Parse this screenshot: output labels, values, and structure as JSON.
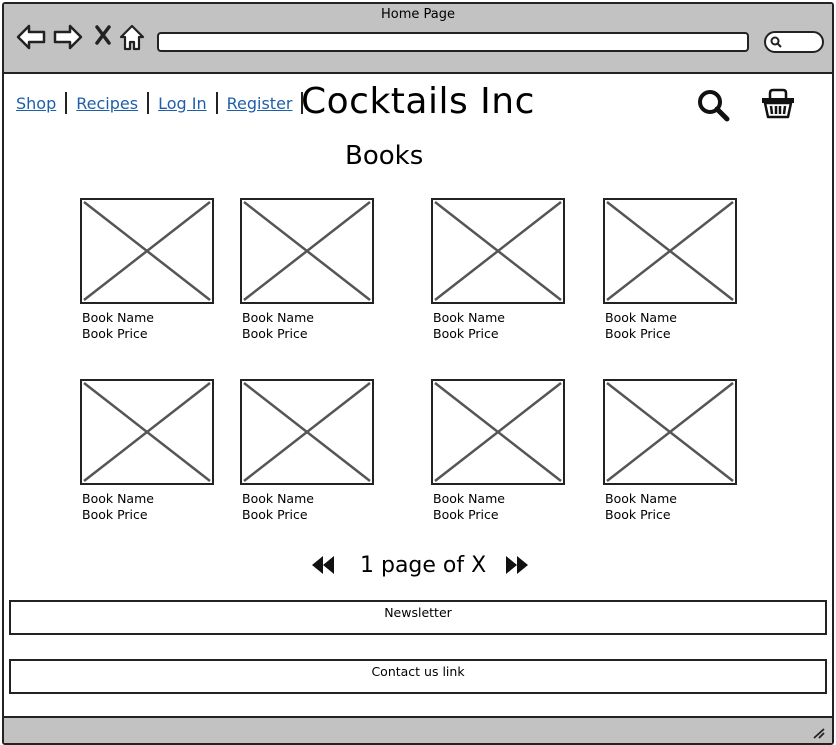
{
  "window": {
    "title": "Home Page"
  },
  "nav": {
    "links": [
      "Shop",
      "Recipes",
      "Log In",
      "Register"
    ]
  },
  "brand": {
    "name": "Cocktails Inc"
  },
  "section": {
    "heading": "Books"
  },
  "books": [
    {
      "name": "Book Name",
      "price": "Book Price"
    },
    {
      "name": "Book Name",
      "price": "Book Price"
    },
    {
      "name": "Book Name",
      "price": "Book Price"
    },
    {
      "name": "Book Name",
      "price": "Book Price"
    },
    {
      "name": "Book Name",
      "price": "Book Price"
    },
    {
      "name": "Book Name",
      "price": "Book Price"
    },
    {
      "name": "Book Name",
      "price": "Book Price"
    },
    {
      "name": "Book Name",
      "price": "Book Price"
    }
  ],
  "pagination": {
    "label": "1 page of X"
  },
  "footer": {
    "newsletter": "Newsletter",
    "contact": "Contact us link"
  },
  "icons": {
    "back": "back-arrow-icon",
    "forward": "forward-arrow-icon",
    "stop": "close-icon",
    "home": "home-icon",
    "search": "search-icon",
    "basket": "basket-icon",
    "prev": "rewind-icon",
    "next": "fast-forward-icon"
  },
  "colors": {
    "chrome": "#c2c2c2",
    "link": "#1f5fa8",
    "stroke": "#222222"
  }
}
